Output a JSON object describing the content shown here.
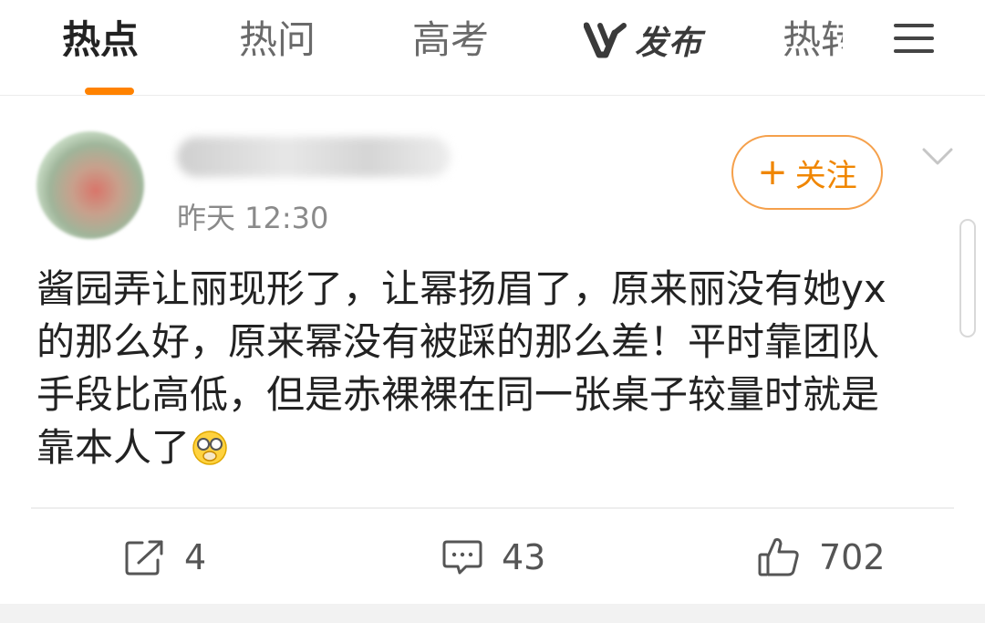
{
  "tabs": [
    {
      "label": "热点",
      "active": true
    },
    {
      "label": "热问",
      "active": false
    },
    {
      "label": "高考",
      "active": false
    },
    {
      "label": "发布",
      "active": false,
      "logo": "v-logo-icon"
    },
    {
      "label": "热转",
      "active": false
    }
  ],
  "accent_color": "#ff8200",
  "post": {
    "time": "昨天 12:30",
    "follow_label": "关注",
    "body_lines": [
      "酱园弄让丽现形了，让幂扬眉了，原来丽没有她yx",
      "的那么好，原来幂没有被踩的那么差！平时靠团队",
      "手段比高低，但是赤裸裸在同一张桌子较量时就是",
      "靠本人了"
    ],
    "emoji": "facepalm-emoji"
  },
  "actions": {
    "repost_count": "4",
    "comment_count": "43",
    "like_count": "702"
  }
}
